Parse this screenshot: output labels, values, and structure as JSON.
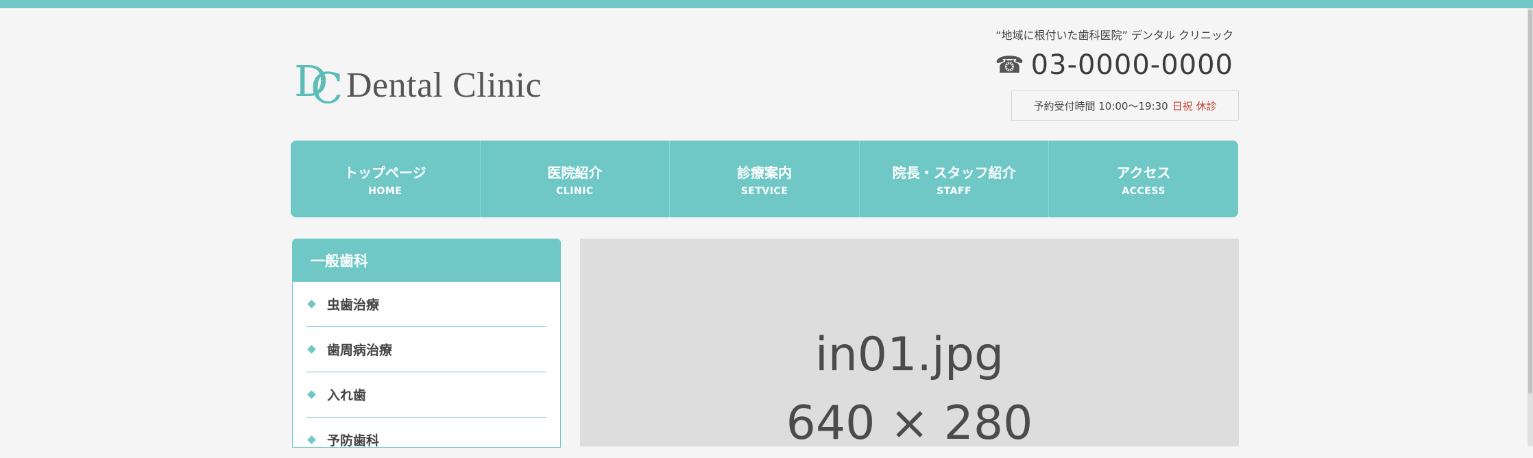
{
  "header": {
    "logo_text": "Dental Clinic",
    "logo_mark_d": "D",
    "logo_mark_c": "C",
    "tagline": "“地域に根付いた歯科医院” デンタル クリニック",
    "phone_icon": "phone-icon",
    "phone": "03-0000-0000",
    "hours_label": "予約受付時間 10:00〜19:30",
    "hours_closed": "日祝 休診"
  },
  "nav": {
    "items": [
      {
        "label": "トップページ",
        "sub": "HOME"
      },
      {
        "label": "医院紹介",
        "sub": "CLINIC"
      },
      {
        "label": "診療案内",
        "sub": "SETVICE"
      },
      {
        "label": "院長・スタッフ紹介",
        "sub": "STAFF"
      },
      {
        "label": "アクセス",
        "sub": "ACCESS"
      }
    ]
  },
  "sidebar": {
    "title": "一般歯科",
    "items": [
      {
        "label": "虫歯治療"
      },
      {
        "label": "歯周病治療"
      },
      {
        "label": "入れ歯"
      },
      {
        "label": "予防歯科"
      }
    ]
  },
  "main_image": {
    "filename": "in01.jpg",
    "dimensions": "640 × 280"
  },
  "colors": {
    "accent": "#6fc8c6",
    "closed": "#c0392b",
    "background": "#f5f5f5",
    "placeholder": "#dddddd"
  }
}
